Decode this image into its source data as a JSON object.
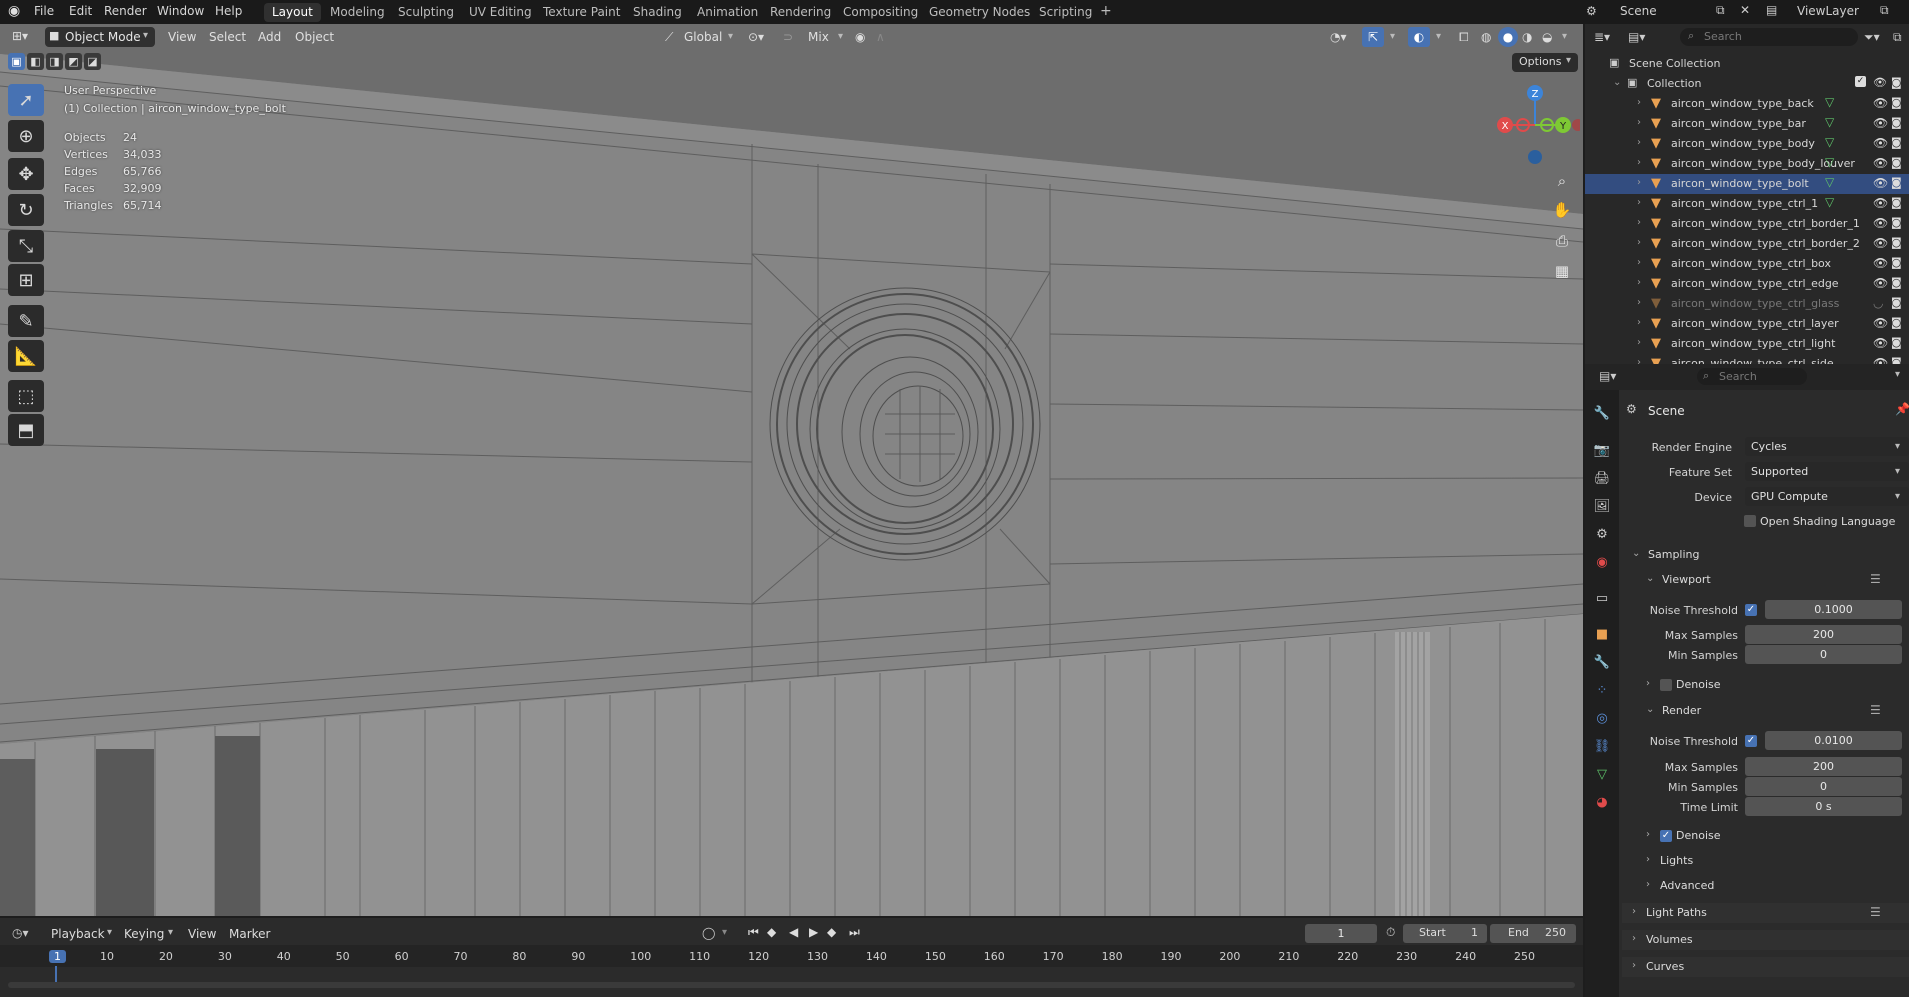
{
  "app_menu": [
    "File",
    "Edit",
    "Render",
    "Window",
    "Help"
  ],
  "workspaces": [
    "Layout",
    "Modeling",
    "Sculpting",
    "UV Editing",
    "Texture Paint",
    "Shading",
    "Animation",
    "Rendering",
    "Compositing",
    "Geometry Nodes",
    "Scripting"
  ],
  "active_workspace": "Layout",
  "scene_name": "Scene",
  "view_layer_name": "ViewLayer",
  "viewport_header": {
    "mode": "Object Mode",
    "menus": [
      "View",
      "Select",
      "Add",
      "Object"
    ],
    "orientation": "Global",
    "snap_mode": "Mix",
    "options_label": "Options"
  },
  "viewport_overlay": {
    "perspective": "User Perspective",
    "collection_path": "(1) Collection | aircon_window_type_bolt",
    "stats": [
      {
        "label": "Objects",
        "value": "24"
      },
      {
        "label": "Vertices",
        "value": "34,033"
      },
      {
        "label": "Edges",
        "value": "65,766"
      },
      {
        "label": "Faces",
        "value": "32,909"
      },
      {
        "label": "Triangles",
        "value": "65,714"
      }
    ]
  },
  "gizmo_axes": [
    "X",
    "Y",
    "Z"
  ],
  "outliner": {
    "search_placeholder": "Search",
    "root": "Scene Collection",
    "collection": "Collection",
    "items": [
      {
        "name": "aircon_window_type_back",
        "hidden": false
      },
      {
        "name": "aircon_window_type_bar",
        "hidden": false
      },
      {
        "name": "aircon_window_type_body",
        "hidden": false
      },
      {
        "name": "aircon_window_type_body_louver",
        "hidden": false
      },
      {
        "name": "aircon_window_type_bolt",
        "hidden": false
      },
      {
        "name": "aircon_window_type_ctrl_1",
        "hidden": false
      },
      {
        "name": "aircon_window_type_ctrl_border_1",
        "hidden": false
      },
      {
        "name": "aircon_window_type_ctrl_border_2",
        "hidden": false
      },
      {
        "name": "aircon_window_type_ctrl_box",
        "hidden": false
      },
      {
        "name": "aircon_window_type_ctrl_edge",
        "hidden": false
      },
      {
        "name": "aircon_window_type_ctrl_glass",
        "hidden": true
      },
      {
        "name": "aircon_window_type_ctrl_layer",
        "hidden": false
      },
      {
        "name": "aircon_window_type_ctrl_light",
        "hidden": false
      },
      {
        "name": "aircon_window_type_ctrl_side",
        "hidden": false
      }
    ]
  },
  "properties": {
    "search_placeholder": "Search",
    "context": "Scene",
    "render_engine_label": "Render Engine",
    "render_engine": "Cycles",
    "feature_set_label": "Feature Set",
    "feature_set": "Supported",
    "device_label": "Device",
    "device": "GPU Compute",
    "osl_label": "Open Shading Language",
    "sampling": "Sampling",
    "viewport": {
      "title": "Viewport",
      "noise_threshold_label": "Noise Threshold",
      "noise_threshold": "0.1000",
      "max_samples_label": "Max Samples",
      "max_samples": "200",
      "min_samples_label": "Min Samples",
      "min_samples": "0",
      "denoise_label": "Denoise"
    },
    "render": {
      "title": "Render",
      "noise_threshold_label": "Noise Threshold",
      "noise_threshold": "0.0100",
      "max_samples_label": "Max Samples",
      "max_samples": "200",
      "min_samples_label": "Min Samples",
      "min_samples": "0",
      "time_limit_label": "Time Limit",
      "time_limit": "0 s",
      "denoise_label": "Denoise"
    },
    "subpanels": [
      "Lights",
      "Advanced"
    ],
    "sections": [
      "Light Paths",
      "Volumes",
      "Curves"
    ]
  },
  "timeline": {
    "menus": [
      "Playback",
      "Keying",
      "View",
      "Marker"
    ],
    "current_frame": "1",
    "start_label": "Start",
    "start": "1",
    "end_label": "End",
    "end": "250",
    "ruler": [
      "1",
      "10",
      "20",
      "30",
      "40",
      "50",
      "60",
      "70",
      "80",
      "90",
      "100",
      "110",
      "120",
      "130",
      "140",
      "150",
      "160",
      "170",
      "180",
      "190",
      "200",
      "210",
      "220",
      "230",
      "240",
      "250"
    ]
  },
  "colors": {
    "accent": "#4772b3",
    "object_icon": "#e8a052",
    "x_axis": "#e04b4b",
    "y_axis": "#7ec934",
    "z_axis": "#3c84d9"
  }
}
